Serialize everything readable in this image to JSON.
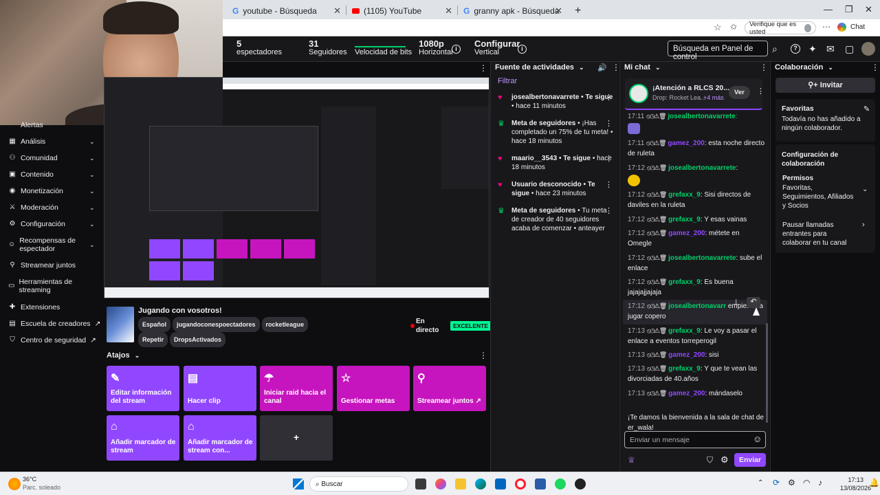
{
  "browser": {
    "tabs": [
      {
        "icon": "google-icon",
        "title": "youtube - Búsqueda"
      },
      {
        "icon": "youtube-icon",
        "title": "(1105) YouTube"
      },
      {
        "icon": "google-icon",
        "title": "granny apk - Búsqueda"
      }
    ],
    "new_tab": "+",
    "verify_label": "Verifique que es usted",
    "chat_label": "Chat"
  },
  "topbar": {
    "stats": [
      {
        "value": "5",
        "label": "espectadores"
      },
      {
        "value": "31",
        "label": "Seguidores"
      },
      {
        "value": "",
        "label": "Velocidad de bits"
      },
      {
        "value": "1080p",
        "label": "Horizontal"
      },
      {
        "value": "Configurar",
        "label": "Vertical"
      }
    ],
    "search_placeholder": "Búsqueda en Panel de control"
  },
  "sidebar": {
    "items": [
      {
        "icon": "bell-icon",
        "label": "Alertas"
      },
      {
        "icon": "chart-icon",
        "label": "Análisis",
        "chevron": "⌄"
      },
      {
        "icon": "community-icon",
        "label": "Comunidad",
        "chevron": "⌄"
      },
      {
        "icon": "content-icon",
        "label": "Contenido",
        "chevron": "⌄"
      },
      {
        "icon": "money-icon",
        "label": "Monetización",
        "chevron": "⌄"
      },
      {
        "icon": "sword-icon",
        "label": "Moderación",
        "chevron": "⌄"
      },
      {
        "icon": "gear-icon",
        "label": "Configuración",
        "chevron": "⌄"
      },
      {
        "icon": "reward-icon",
        "label": "Recompensas de espectador",
        "chevron": "⌄"
      },
      {
        "icon": "together-icon",
        "label": "Streamear juntos"
      },
      {
        "icon": "tools-icon",
        "label": "Herramientas de streaming"
      },
      {
        "icon": "puzzle-icon",
        "label": "Extensiones"
      },
      {
        "icon": "school-icon",
        "label": "Escuela de creadores",
        "ext": "↗"
      },
      {
        "icon": "shield-icon",
        "label": "Centro de seguridad",
        "ext": "↗"
      }
    ]
  },
  "stream": {
    "title": "Jugando con vosotros!",
    "tags": [
      "Español",
      "jugandoconespoectadores",
      "rocketleague",
      "Repetir",
      "DropsActivados"
    ],
    "live_label": "En directo",
    "quality_badge": "EXCELENTE"
  },
  "shortcuts": {
    "header": "Atajos",
    "items": [
      {
        "icon": "pencil-icon",
        "label": "Editar información del stream"
      },
      {
        "icon": "clip-icon",
        "label": "Hacer clip"
      },
      {
        "icon": "raid-icon",
        "label": "Iniciar raid hacia el canal"
      },
      {
        "icon": "star-icon",
        "label": "Gestionar metas"
      },
      {
        "icon": "together-icon",
        "label": "Streamear juntos ↗"
      },
      {
        "icon": "bookmark-icon",
        "label": "Añadir marcador de stream"
      },
      {
        "icon": "bookmark-icon",
        "label": "Añadir marcador de stream con..."
      },
      {
        "icon": "plus-icon",
        "label": "+"
      }
    ]
  },
  "activity": {
    "header": "Fuente de actividades",
    "filter": "Filtrar",
    "items": [
      {
        "icon": "heart-icon",
        "user": "josealbertonavarrete",
        "text": " • Te sigue",
        "time": " • hace 11 minutos"
      },
      {
        "icon": "trophy-icon",
        "user": "Meta de seguidores",
        "text": " • ¡Has completado un 75% de tu meta!",
        "time": " • hace 18 minutos"
      },
      {
        "icon": "heart-icon",
        "user": "maario__3543",
        "text": " • Te sigue",
        "time": " • hace 18 minutos"
      },
      {
        "icon": "heart-icon",
        "user": "Usuario desconocido",
        "text": " • Te sigue",
        "time": " • hace 23 minutos"
      },
      {
        "icon": "trophy-icon",
        "user": "Meta de seguidores",
        "text": " • Tu meta de creador de 40 seguidores acaba de comenzar",
        "time": " • anteayer"
      }
    ]
  },
  "chat": {
    "header": "Mi chat",
    "pinned": {
      "title": "¡Atención a RLCS 20...",
      "sub": "Drop: Rocket Lea...",
      "more": "+4 más",
      "button": "Ver"
    },
    "messages": [
      {
        "time": "17:11",
        "user": "josealbertonavarrete",
        "color": "#00d26a",
        "text": " "
      },
      {
        "time": "17:11",
        "user": "gamez_200",
        "color": "#9147ff",
        "text": ": esta noche directo de ruleta"
      },
      {
        "time": "17:12",
        "user": "josealbertonavarrete",
        "color": "#00d26a",
        "text": ":"
      },
      {
        "time": "17:12",
        "user": "grefaxx_9",
        "color": "#00d26a",
        "text": ": Sisi directos de daviles en la ruleta"
      },
      {
        "time": "17:12",
        "user": "grefaxx_9",
        "color": "#00d26a",
        "text": ": Y esas vainas"
      },
      {
        "time": "17:12",
        "user": "gamez_200",
        "color": "#9147ff",
        "text": ": métete en Omegle"
      },
      {
        "time": "17:12",
        "user": "josealbertonavarrete",
        "color": "#00d26a",
        "text": ": sube el enlace"
      },
      {
        "time": "17:12",
        "user": "grefaxx_9",
        "color": "#00d26a",
        "text": ": Es buena jajajajjajaja"
      },
      {
        "time": "17:12",
        "user": "josealbertonavarr",
        "color": "#00d26a",
        "text": " empiezas a jugar copero"
      },
      {
        "time": "17:13",
        "user": "grefaxx_9",
        "color": "#00d26a",
        "text": ": Le voy a pasar el enlace a eventos torreperogil"
      },
      {
        "time": "17:13",
        "user": "gamez_200",
        "color": "#9147ff",
        "text": ": sisi"
      },
      {
        "time": "17:13",
        "user": "grefaxx_9",
        "color": "#00d26a",
        "text": ": Y que te vean las divorciadas de 40.años"
      },
      {
        "time": "17:13",
        "user": "gamez_200",
        "color": "#9147ff",
        "text": ": mándaselo"
      }
    ],
    "welcome": "¡Te damos la bienvenida a la sala de chat de er_wala!",
    "input_placeholder": "Enviar un mensaje",
    "send": "Enviar"
  },
  "collab": {
    "header": "Colaboración",
    "invite": "Invitar",
    "favorites_title": "Favoritas",
    "favorites_text": "Todavía no has añadido a ningún colaborador.",
    "config_title": "Configuración de colaboración",
    "permissions_title": "Permisos",
    "permissions_text": "Favoritas, Seguimientos, Afiliados y Socios",
    "pause_text": "Pausar llamadas entrantes para colaborar en tu canal"
  },
  "taskbar": {
    "weather_temp": "36°C",
    "weather_desc": "Parc. soleado",
    "search": "Buscar",
    "time": "17:13",
    "date": "13/08/2026"
  }
}
